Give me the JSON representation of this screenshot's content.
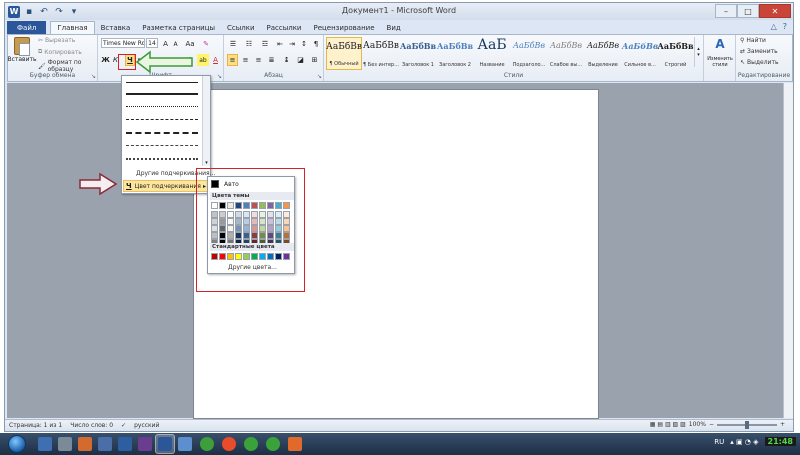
{
  "title_bar": {
    "title": "Документ1 - Microsoft Word",
    "app_icon_letter": "W",
    "window_controls": [
      "minimize",
      "maximize",
      "close"
    ]
  },
  "ribbon_tabs": [
    {
      "label": "Файл"
    },
    {
      "label": "Главная"
    },
    {
      "label": "Вставка"
    },
    {
      "label": "Разметка страницы"
    },
    {
      "label": "Ссылки"
    },
    {
      "label": "Рассылки"
    },
    {
      "label": "Рецензирование"
    },
    {
      "label": "Вид"
    }
  ],
  "clipboard_group": {
    "label": "Буфер обмена",
    "paste_label": "Вставить",
    "cut_label": "Вырезать",
    "copy_label": "Копировать",
    "format_painter_label": "Формат по образцу"
  },
  "font_group": {
    "label": "Шрифт",
    "font_name": "Times New Ro",
    "font_size": "14",
    "bold": "Ж",
    "italic": "К",
    "underline": "Ч",
    "strike": "abe",
    "subscript": "x₂",
    "superscript": "x²",
    "grow": "A",
    "shrink": "A",
    "case": "Aa",
    "font_color": "A",
    "highlight": "ab"
  },
  "paragraph_group": {
    "label": "Абзац"
  },
  "styles_group": {
    "label": "Стили",
    "styles": [
      {
        "sample": "АаБбВв",
        "name": "¶ Обычный",
        "selected": true
      },
      {
        "sample": "АаБбВв",
        "name": "¶ Без интер...",
        "selected": false
      },
      {
        "sample": "АаБбВв",
        "name": "Заголовок 1",
        "selected": false
      },
      {
        "sample": "АаБбВв",
        "name": "Заголовок 2",
        "selected": false
      },
      {
        "sample": "АаБ",
        "name": "Название",
        "selected": false
      },
      {
        "sample": "АаБбВв",
        "name": "Подзаголо...",
        "selected": false
      },
      {
        "sample": "АаБбВв",
        "name": "Слабое вы...",
        "selected": false
      },
      {
        "sample": "АаБбВв",
        "name": "Выделение",
        "selected": false
      },
      {
        "sample": "АаБбВв",
        "name": "Сильное в...",
        "selected": false
      },
      {
        "sample": "АаБбВв",
        "name": "Строгий",
        "selected": false
      },
      {
        "sample": "АаБбВв",
        "name": "",
        "selected": false
      }
    ],
    "change_styles_label": "Изменить стили"
  },
  "editing_group": {
    "label": "Редактирование",
    "find_label": "Найти",
    "replace_label": "Заменить",
    "select_label": "Выделить"
  },
  "underline_menu": {
    "more_underlines_label": "Другие подчеркивания...",
    "underline_color_label": "Цвет подчеркивания"
  },
  "color_palette": {
    "auto_label": "Авто",
    "theme_colors_header": "Цвета темы",
    "standard_colors_header": "Стандартные цвета",
    "more_colors_label": "Другие цвета...",
    "theme_colors": [
      "#FFFFFF",
      "#000000",
      "#EEECE1",
      "#1F497D",
      "#4F81BD",
      "#C0504D",
      "#9BBB59",
      "#8064A2",
      "#4BACC6",
      "#F79646"
    ],
    "standard_colors": [
      "#C00000",
      "#FF0000",
      "#FFC000",
      "#FFFF00",
      "#92D050",
      "#00B050",
      "#00B0F0",
      "#0070C0",
      "#002060",
      "#7030A0"
    ]
  },
  "status_bar": {
    "page": "Страница: 1 из 1",
    "words": "Число слов: 0",
    "language": "русский",
    "zoom": "100%"
  },
  "taskbar": {
    "language": "RU",
    "clock": "21:48"
  },
  "colors": {
    "annotation_red": "#D3222A",
    "word_blue": "#2B579A",
    "highlight_yellow": "#FDE59C"
  }
}
